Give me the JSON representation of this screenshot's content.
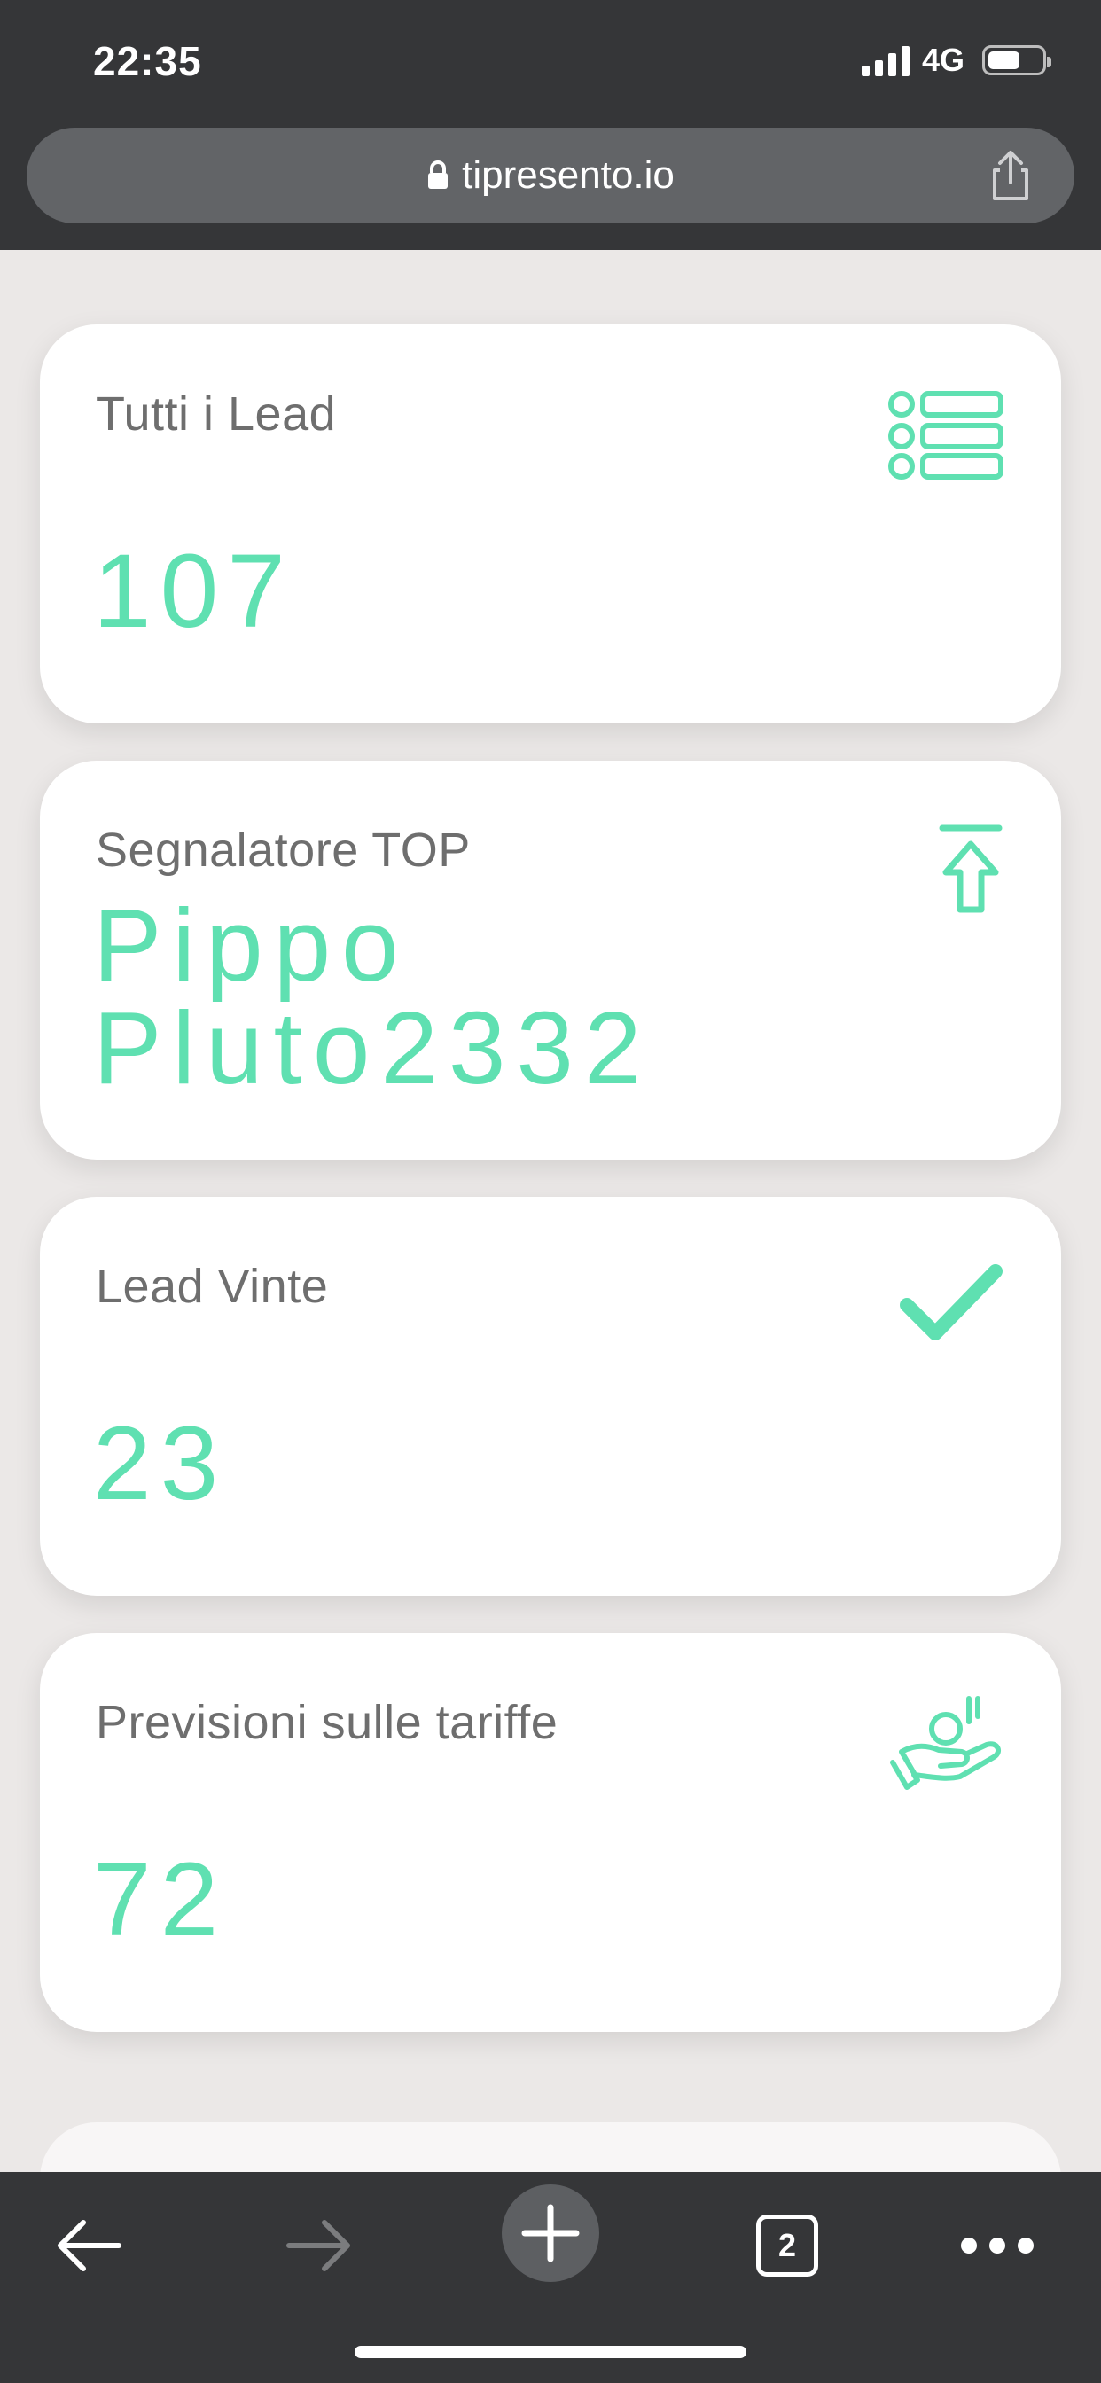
{
  "status_bar": {
    "time": "22:35",
    "network": "4G",
    "battery_level": 0.6
  },
  "browser": {
    "url": "tipresento.io",
    "lock_icon": "lock-icon",
    "share_icon": "share-icon",
    "open_tabs": "2"
  },
  "cards": [
    {
      "label": "Tutti i Lead",
      "value": "107",
      "icon": "list-icon"
    },
    {
      "label": "Segnalatore TOP",
      "value": "Pippo Pluto2332",
      "icon": "arrow-up-to-top-icon"
    },
    {
      "label": "Lead Vinte",
      "value": "23",
      "icon": "checkmark-icon"
    },
    {
      "label": "Previsioni sulle tariffe",
      "value": "72",
      "icon": "hand-coin-icon"
    }
  ],
  "theme": {
    "accent": "#5fe0b1",
    "chrome": "#353638",
    "background": "#ebe8e7"
  }
}
